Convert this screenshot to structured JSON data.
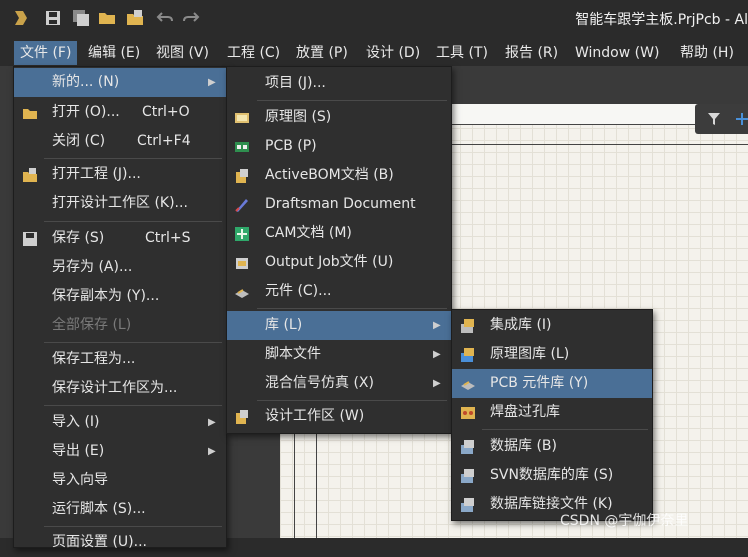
{
  "window": {
    "title": "智能车跟学主板.PrjPcb - Al"
  },
  "menubar": [
    {
      "label": "文件 (F)"
    },
    {
      "label": "编辑 (E)"
    },
    {
      "label": "视图 (V)"
    },
    {
      "label": "工程 (C)"
    },
    {
      "label": "放置 (P)"
    },
    {
      "label": "设计 (D)"
    },
    {
      "label": "工具 (T)"
    },
    {
      "label": "报告 (R)"
    },
    {
      "label": "Window (W)"
    },
    {
      "label": "帮助 (H)"
    }
  ],
  "file_menu": [
    {
      "label": "新的... (N)",
      "shortcut": "",
      "submenu": true,
      "highlighted": true
    },
    {
      "label": "打开 (O)...",
      "shortcut": "Ctrl+O"
    },
    {
      "label": "关闭 (C)",
      "shortcut": "Ctrl+F4"
    },
    {
      "label": "打开工程 (J)..."
    },
    {
      "label": "打开设计工作区 (K)..."
    },
    {
      "label": "保存 (S)",
      "shortcut": "Ctrl+S"
    },
    {
      "label": "另存为 (A)..."
    },
    {
      "label": "保存副本为 (Y)..."
    },
    {
      "label": "全部保存 (L)",
      "disabled": true
    },
    {
      "label": "保存工程为..."
    },
    {
      "label": "保存设计工作区为..."
    },
    {
      "label": "导入 (I)",
      "submenu": true
    },
    {
      "label": "导出 (E)",
      "submenu": true
    },
    {
      "label": "导入向导"
    },
    {
      "label": "运行脚本 (S)..."
    },
    {
      "label": "页面设置 (U)..."
    }
  ],
  "new_menu": [
    {
      "label": "项目 (J)..."
    },
    {
      "label": "原理图 (S)"
    },
    {
      "label": "PCB (P)"
    },
    {
      "label": "ActiveBOM文档 (B)"
    },
    {
      "label": "Draftsman Document"
    },
    {
      "label": "CAM文档 (M)"
    },
    {
      "label": "Output Job文件 (U)"
    },
    {
      "label": "元件 (C)..."
    },
    {
      "label": "库 (L)",
      "submenu": true,
      "highlighted": true
    },
    {
      "label": "脚本文件",
      "submenu": true
    },
    {
      "label": "混合信号仿真 (X)",
      "submenu": true
    },
    {
      "label": "设计工作区 (W)"
    }
  ],
  "lib_menu": [
    {
      "label": "集成库 (I)"
    },
    {
      "label": "原理图库 (L)"
    },
    {
      "label": "PCB 元件库 (Y)",
      "highlighted": true
    },
    {
      "label": "焊盘过孔库"
    },
    {
      "label": "数据库 (B)"
    },
    {
      "label": "SVN数据库的库 (S)"
    },
    {
      "label": "数据库链接文件 (K)"
    }
  ],
  "watermark": "CSDN @宇伽伊奈里"
}
